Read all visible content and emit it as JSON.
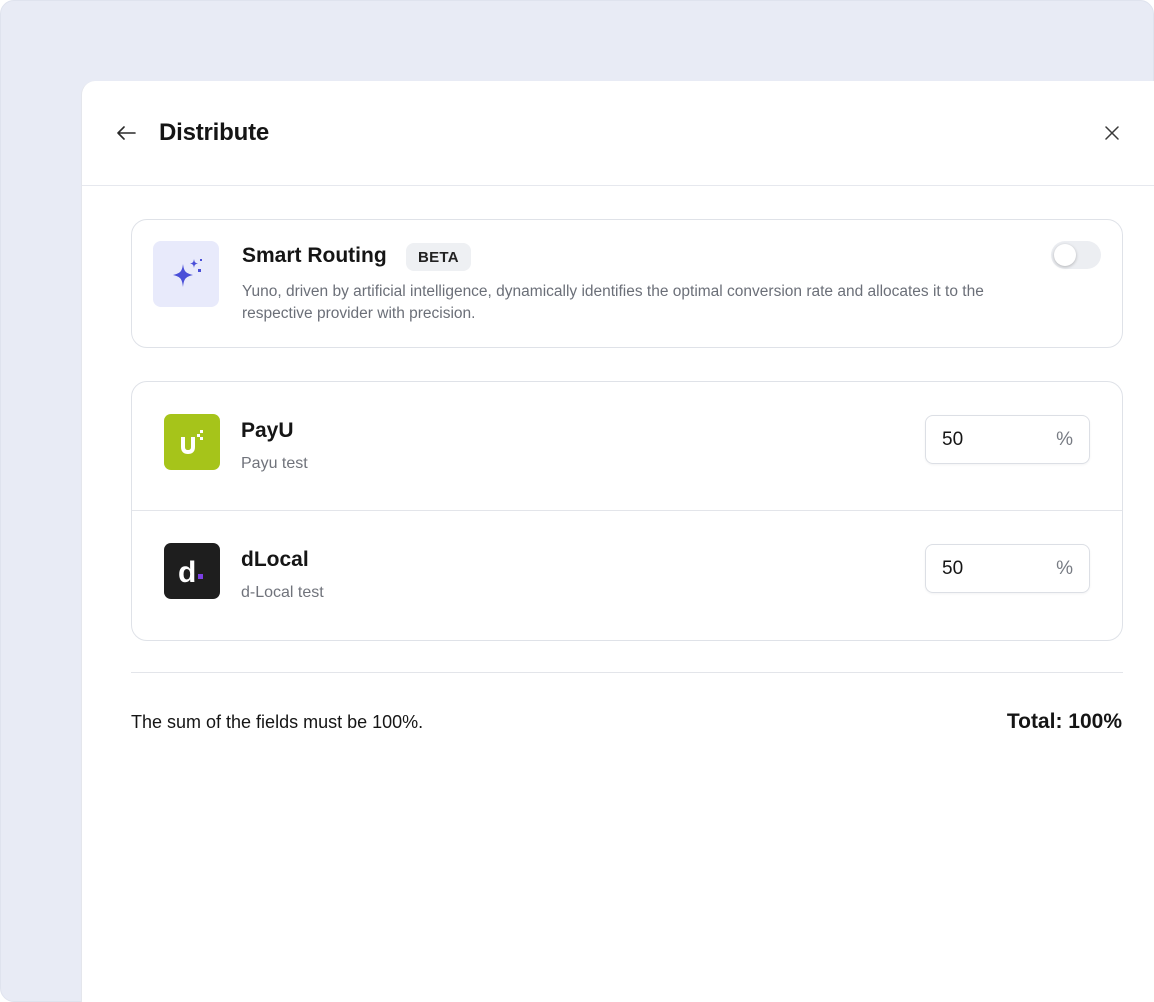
{
  "header": {
    "title": "Distribute",
    "back_icon": "arrow-left-icon",
    "close_icon": "close-icon"
  },
  "smart_routing": {
    "icon": "sparkles-icon",
    "title": "Smart Routing",
    "badge": "BETA",
    "description": "Yuno, driven by artificial intelligence, dynamically identifies the optimal conversion rate and allocates it to the respective provider with precision.",
    "enabled": false,
    "accent_color": "#4a4fd8"
  },
  "providers": [
    {
      "name": "PayU",
      "subtitle": "Payu test",
      "percentage": "50",
      "unit": "%",
      "logo_color": "#a6c41a"
    },
    {
      "name": "dLocal",
      "subtitle": "d-Local test",
      "percentage": "50",
      "unit": "%",
      "logo_color": "#1e1e1e"
    }
  ],
  "footer": {
    "note": "The sum of the fields must be 100%.",
    "total": "Total: 100%"
  }
}
